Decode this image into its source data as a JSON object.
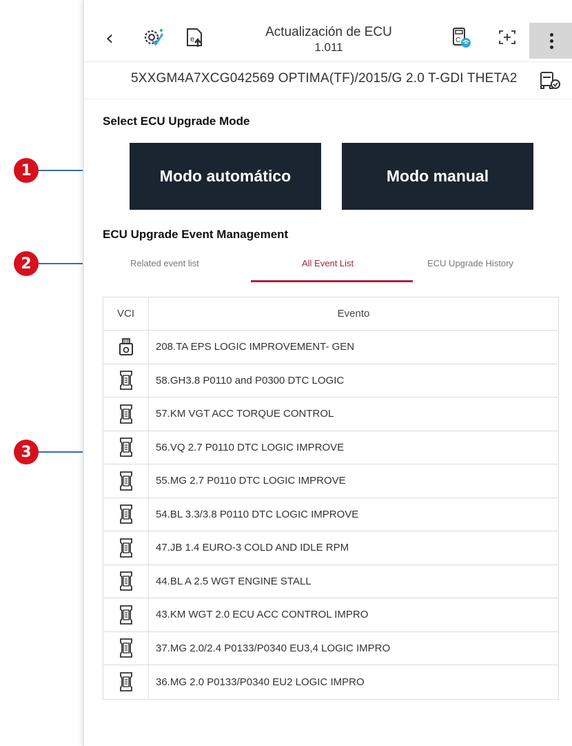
{
  "header": {
    "title_line1": "Actualización de ECU",
    "title_line2": "1.011",
    "icons": [
      "chevron-left-icon",
      "gear-check-icon",
      "ecu-upload-icon",
      "vci-wifi-icon",
      "screen-capture-icon",
      "more-vertical-icon"
    ]
  },
  "vehicle": {
    "info": "5XXGM4A7XCG042569  OPTIMA(TF)/2015/G 2.0 T-GDI THETA2",
    "icon": "vehicle-check-icon"
  },
  "upgrade_mode": {
    "heading": "Select ECU Upgrade Mode",
    "auto_label": "Modo automático",
    "manual_label": "Modo manual"
  },
  "event_management": {
    "heading": "ECU Upgrade Event Management",
    "tabs": [
      {
        "label": "Related event list",
        "active": false
      },
      {
        "label": "All Event List",
        "active": true
      },
      {
        "label": "ECU Upgrade History",
        "active": false
      }
    ]
  },
  "table": {
    "headers": {
      "vci": "VCI",
      "event": "Evento"
    },
    "rows": [
      {
        "vci_icon": "vci-ii-icon",
        "event": "208.TA EPS LOGIC IMPROVEMENT- GEN"
      },
      {
        "vci_icon": "vci-device-icon",
        "event": "58.GH3.8  P0110 and P0300 DTC LOGIC"
      },
      {
        "vci_icon": "vci-device-icon",
        "event": "57.KM VGT ACC TORQUE CONTROL"
      },
      {
        "vci_icon": "vci-device-icon",
        "event": "56.VQ 2.7 P0110 DTC LOGIC IMPROVE"
      },
      {
        "vci_icon": "vci-device-icon",
        "event": "55.MG 2.7 P0110 DTC LOGIC IMPROVE"
      },
      {
        "vci_icon": "vci-device-icon",
        "event": "54.BL 3.3/3.8 P0110 DTC LOGIC IMPROVE"
      },
      {
        "vci_icon": "vci-device-icon",
        "event": "47.JB 1.4 EURO-3 COLD AND IDLE RPM"
      },
      {
        "vci_icon": "vci-device-icon",
        "event": "44.BL A 2.5 WGT ENGINE STALL"
      },
      {
        "vci_icon": "vci-device-icon",
        "event": "43.KM WGT 2.0 ECU ACC CONTROL IMPRO"
      },
      {
        "vci_icon": "vci-device-icon",
        "event": "37.MG 2.0/2.4 P0133/P0340 EU3,4 LOGIC IMPRO"
      },
      {
        "vci_icon": "vci-device-icon",
        "event": "36.MG 2.0 P0133/P0340 EU2 LOGIC IMPRO"
      }
    ]
  },
  "callouts": [
    {
      "number": "1"
    },
    {
      "number": "2"
    },
    {
      "number": "3"
    }
  ],
  "colors": {
    "button_bg": "#1b2531",
    "accent": "#a5253b",
    "callout_badge": "#d8101c",
    "callout_line": "#3a6da8"
  }
}
